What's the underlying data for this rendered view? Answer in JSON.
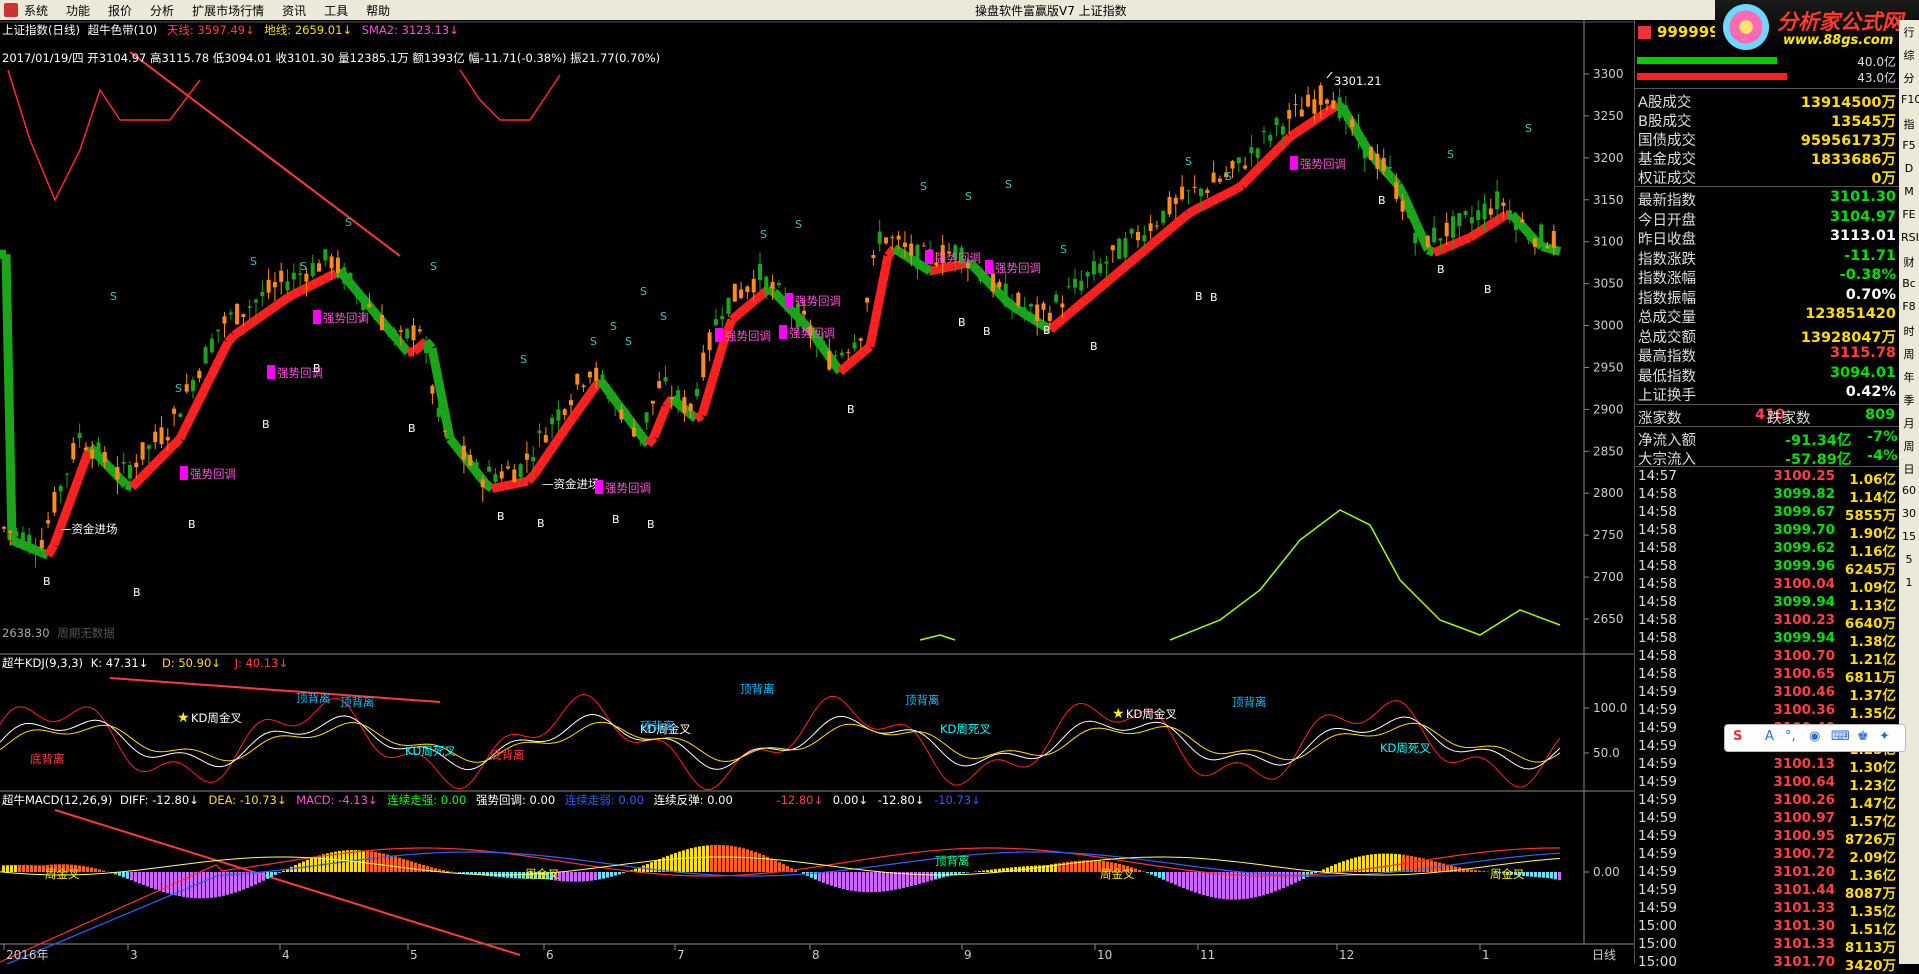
{
  "menu": {
    "items": [
      "系统",
      "功能",
      "报价",
      "分析",
      "扩展市场行情",
      "资讯",
      "工具",
      "帮助"
    ],
    "title": "操盘软件富赢版V7  上证指数"
  },
  "logo": {
    "name": "分析家公式网",
    "url": "www.88gs.com"
  },
  "main": {
    "title": "上证指数(日线)",
    "indicator": "超牛色带(10)",
    "tian": "天线: 3597.49↓",
    "di": "地线: 2659.01↓",
    "sma": "SMA2: 3123.13↓",
    "info": "2017/01/19/四 开3104.97 高3115.78 低3094.01 收3101.30 量12385.1万 额1393亿 幅-11.71(-0.38%) 振21.77(0.70%)",
    "price_axis": [
      "3300",
      "3250",
      "3200",
      "3150",
      "3100",
      "3050",
      "3000",
      "2950",
      "2900",
      "2850",
      "2800",
      "2750",
      "2700",
      "2650"
    ],
    "high_label": "3301.21",
    "low_label": "2638.30",
    "low_caption": "周期无数据",
    "annotations": {
      "zjjc": "资金进场",
      "qshd": "强势回调",
      "s": "S",
      "b": "B"
    }
  },
  "kdj": {
    "title": "超牛KDJ(9,3,3)",
    "k": "K: 47.31↓",
    "d": "D: 50.90↓",
    "j": "J: 40.13↓",
    "axis": [
      "100.0",
      "50.0"
    ],
    "annotations": {
      "jx": "KD周金叉",
      "sx": "KD周死叉",
      "dbl": "顶背离",
      "dibl": "底背离"
    }
  },
  "macd": {
    "title": "超牛MACD(12,26,9)",
    "diff": "DIFF: -12.80↓",
    "dea": "DEA: -10.73↓",
    "macd": "MACD: -4.13↓",
    "lxzq": "连续走强: 0.00",
    "qshd": "强势回调: 0.00",
    "lxjd": "连续走弱: 0.00",
    "lxft": "连续反弹: 0.00",
    "r1": "-12.80↓",
    "r2": "0.00↓",
    "r3": "-12.80↓",
    "r4": "-10.73↓",
    "axis": "0.00",
    "annotations": {
      "jx": "周金叉",
      "dbl": "顶背离"
    }
  },
  "time_axis": [
    "2016年",
    "3",
    "4",
    "5",
    "6",
    "7",
    "8",
    "9",
    "10",
    "11",
    "12",
    "1"
  ],
  "period": "日线",
  "side": {
    "code": "999999",
    "bar1": "40.0亿",
    "bar2": "43.0亿",
    "stats": [
      [
        "A股成交",
        "13914500万",
        "#ffdd00"
      ],
      [
        "B股成交",
        "13545万",
        "#ffdd00"
      ],
      [
        "国债成交",
        "95956173万",
        "#ffdd00"
      ],
      [
        "基金成交",
        "1833686万",
        "#ffdd00"
      ],
      [
        "权证成交",
        "0万",
        "#ffdd00"
      ]
    ],
    "quote": [
      [
        "最新指数",
        "3101.30",
        "#00e000"
      ],
      [
        "今日开盘",
        "3104.97",
        "#00e000"
      ],
      [
        "昨日收盘",
        "3113.01",
        "#ffffff"
      ],
      [
        "指数涨跌",
        "-11.71",
        "#00e000"
      ],
      [
        "指数涨幅",
        "-0.38%",
        "#00e000"
      ],
      [
        "指数振幅",
        "0.70%",
        "#ffffff"
      ],
      [
        "总成交量",
        "123851420",
        "#ffdd00"
      ],
      [
        "总成交额",
        "13928047万",
        "#ffdd00"
      ],
      [
        "最高指数",
        "3115.78",
        "#ff4040"
      ],
      [
        "最低指数",
        "3094.01",
        "#00e000"
      ],
      [
        "上证换手",
        "0.42%",
        "#ffffff"
      ]
    ],
    "updown": {
      "up_label": "涨家数",
      "up": "410",
      "down_label": "跌家数",
      "down": "809"
    },
    "flow": [
      [
        "净流入额",
        "-91.34亿",
        "-7%"
      ],
      [
        "大宗流入",
        "-57.89亿",
        "-4%"
      ]
    ],
    "ticks": [
      [
        "14:57",
        "3100.25",
        "1.06亿"
      ],
      [
        "14:58",
        "3099.82",
        "1.14亿"
      ],
      [
        "14:58",
        "3099.67",
        "5855万"
      ],
      [
        "14:58",
        "3099.70",
        "1.90亿"
      ],
      [
        "14:58",
        "3099.62",
        "1.16亿"
      ],
      [
        "14:58",
        "3099.96",
        "6245万"
      ],
      [
        "14:58",
        "3100.04",
        "1.09亿"
      ],
      [
        "14:58",
        "3099.94",
        "1.13亿"
      ],
      [
        "14:58",
        "3100.23",
        "6640万"
      ],
      [
        "14:58",
        "3099.94",
        "1.38亿"
      ],
      [
        "14:58",
        "3100.70",
        "1.21亿"
      ],
      [
        "14:58",
        "3100.65",
        "6811万"
      ],
      [
        "14:59",
        "3100.46",
        "1.37亿"
      ],
      [
        "14:59",
        "3100.36",
        "1.35亿"
      ],
      [
        "14:59",
        "3100.40",
        "7874万"
      ],
      [
        "14:59",
        "3100.23",
        "1.25亿"
      ],
      [
        "14:59",
        "3100.13",
        "1.30亿"
      ],
      [
        "14:59",
        "3100.64",
        "1.23亿"
      ],
      [
        "14:59",
        "3100.26",
        "1.47亿"
      ],
      [
        "14:59",
        "3100.97",
        "1.57亿"
      ],
      [
        "14:59",
        "3100.95",
        "8726万"
      ],
      [
        "14:59",
        "3100.72",
        "2.09亿"
      ],
      [
        "14:59",
        "3101.20",
        "1.36亿"
      ],
      [
        "14:59",
        "3101.44",
        "8087万"
      ],
      [
        "14:59",
        "3101.33",
        "1.35亿"
      ],
      [
        "15:00",
        "3101.30",
        "1.51亿"
      ],
      [
        "15:00",
        "3101.33",
        "8113万"
      ],
      [
        "15:00",
        "3101.70",
        "3420万"
      ]
    ]
  },
  "toolbar": [
    "行",
    "综",
    "分",
    "F10",
    "指",
    "F5",
    "D",
    "M",
    "FE",
    "RSI",
    "财",
    "Bc",
    "F8",
    "时",
    "周",
    "年",
    "季",
    "月",
    "周",
    "日",
    "60",
    "30",
    "15",
    "5",
    "1"
  ],
  "colors": {
    "up": "#ff3b30",
    "down": "#00c000",
    "candle_up": "#ff8c1a",
    "band_green": "#1aa51a",
    "band_red": "#ff2020"
  }
}
